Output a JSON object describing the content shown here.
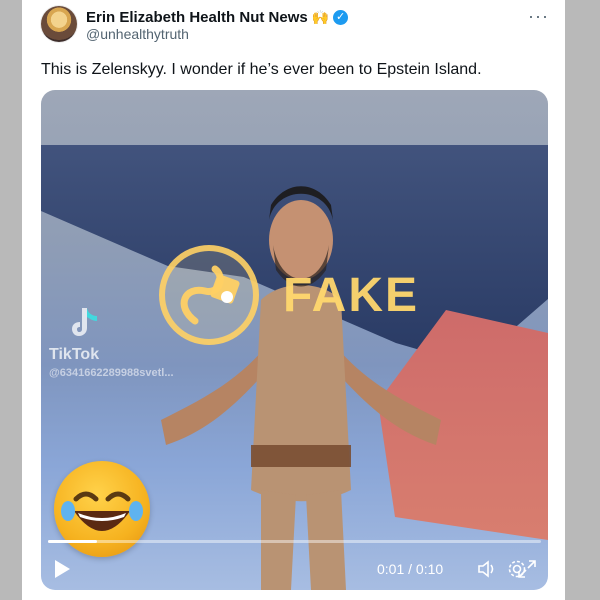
{
  "tweet": {
    "display_name": "Erin Elizabeth Health Nut News",
    "name_emoji": "🙌",
    "handle": "@unhealthytruth",
    "text": "This is Zelenskyy. I wonder if he’s ever been to Epstein Island.",
    "more_label": "···",
    "verified_icon": "verified-badge-icon",
    "verified_color": "#1d9bf0"
  },
  "video": {
    "watermark_text": "FAKE",
    "tiktok_label": "TikTok",
    "tiktok_user": "@6341662289988svetl...",
    "time_display": "0:01 / 0:10",
    "progress_percent": 10,
    "controls": [
      "play-icon",
      "volume-icon",
      "settings-icon",
      "fullscreen-icon"
    ]
  }
}
